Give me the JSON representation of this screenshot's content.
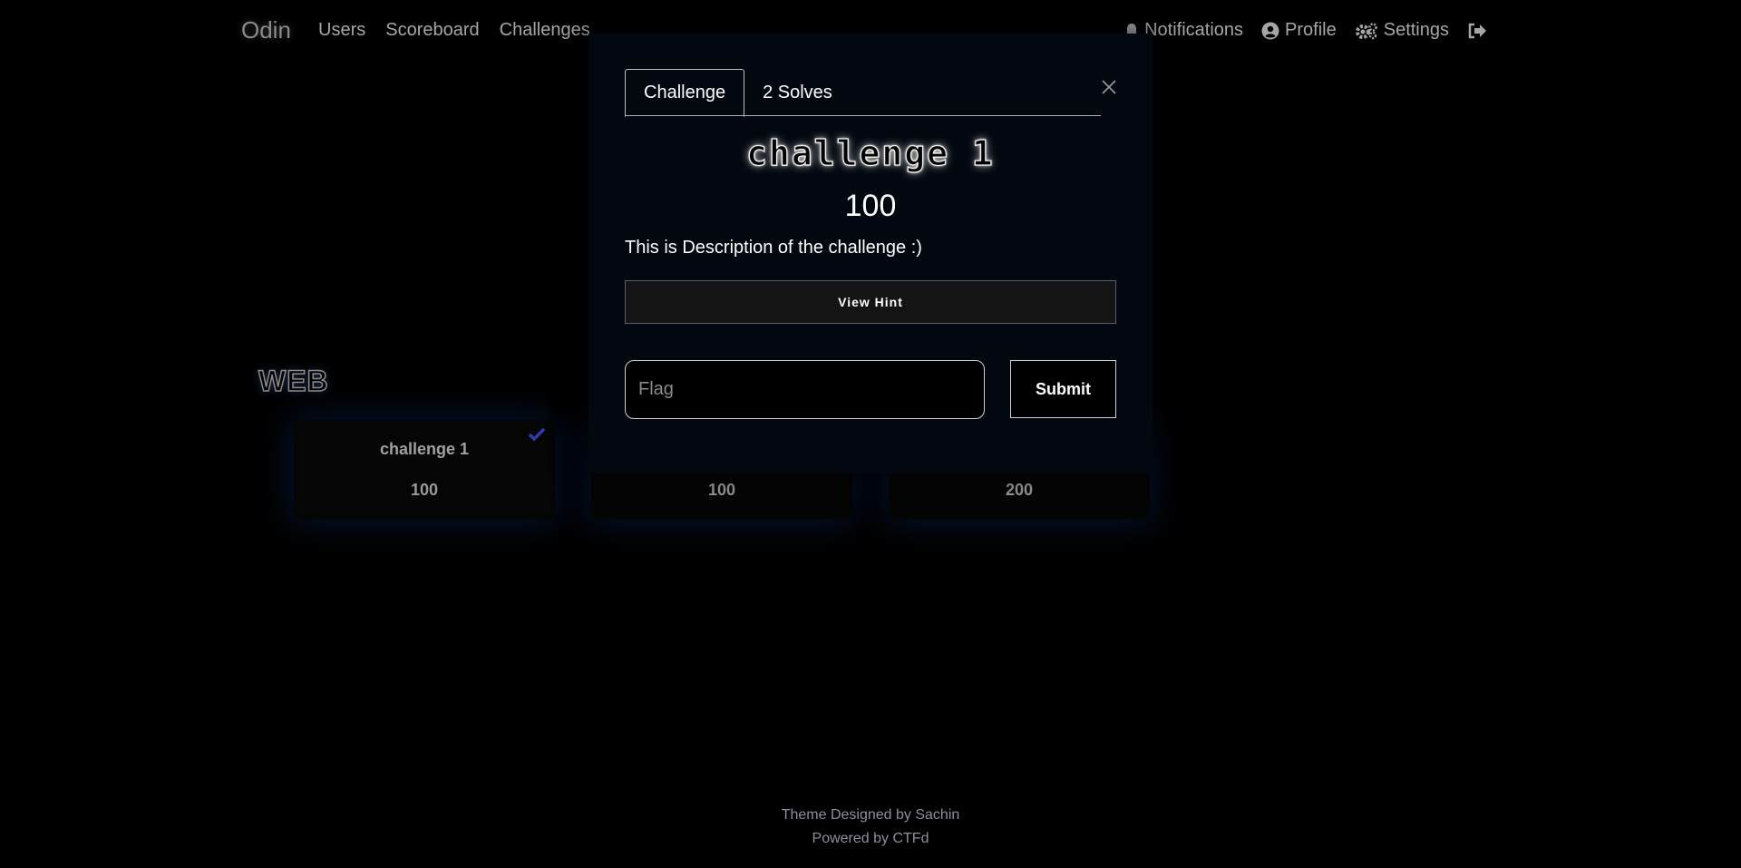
{
  "navbar": {
    "brand": "Odin",
    "links": [
      "Users",
      "Scoreboard",
      "Challenges"
    ],
    "notifications": "Notifications",
    "profile": "Profile",
    "settings": "Settings",
    "icons": [
      "bell-icon",
      "user-circle-icon",
      "gears-icon",
      "logout-icon"
    ]
  },
  "board": {
    "category": "WEB",
    "cards": [
      {
        "title": "challenge 1",
        "value": "100",
        "solved": true
      },
      {
        "title": "",
        "value": "100",
        "solved": false
      },
      {
        "title": "",
        "value": "200",
        "solved": false
      }
    ]
  },
  "modal": {
    "tabs": [
      "Challenge",
      "2 Solves"
    ],
    "name": "challenge 1",
    "value": "100",
    "description": "This is Description of the challenge :)",
    "hint_label": "View Hint",
    "flag_placeholder": "Flag",
    "submit_label": "Submit"
  },
  "footer": {
    "line1": "Theme Designed by Sachin",
    "line2": "Powered by CTFd"
  },
  "colors": {
    "background": "#000000",
    "modal_bg": "#030810",
    "check": "#2f3bb0",
    "card_glow": "#1446a0"
  }
}
